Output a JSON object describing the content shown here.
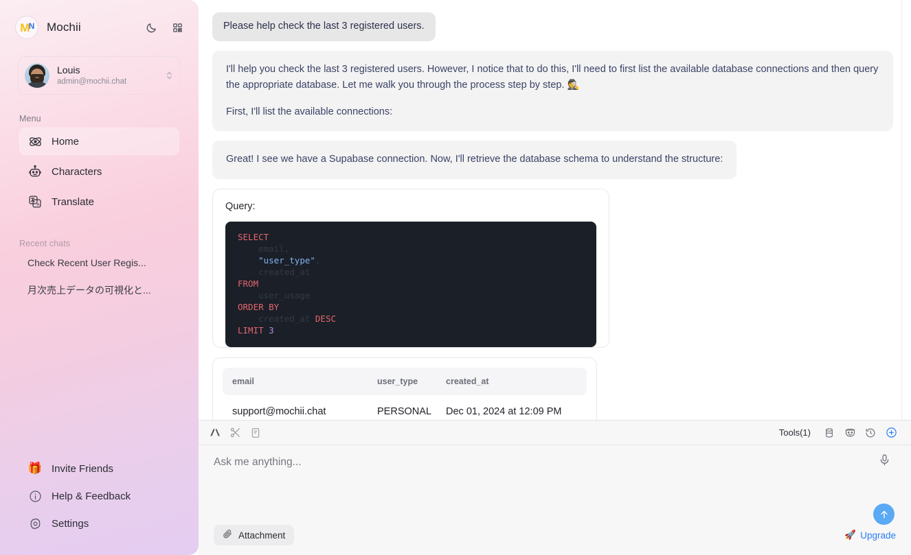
{
  "sidebar": {
    "brand": {
      "name": "Mochii",
      "logo_letter": "M",
      "logo_accent": "ᴺ"
    },
    "header_icons": [
      {
        "name": "dark-mode-toggle",
        "icon": "moon-icon"
      },
      {
        "name": "qr-code-button",
        "icon": "qr-code-icon"
      }
    ],
    "user": {
      "name": "Louis",
      "email": "admin@mochii.chat"
    },
    "menu_label": "Menu",
    "items": [
      {
        "label": "Home",
        "icon": "atom-icon",
        "active": true
      },
      {
        "label": "Characters",
        "icon": "robot-icon",
        "active": false
      },
      {
        "label": "Translate",
        "icon": "translate-icon",
        "active": false
      }
    ],
    "recent_label": "Recent chats",
    "recent": [
      {
        "label": "Check Recent User Regis..."
      },
      {
        "label": "月次売上データの可視化と..."
      }
    ],
    "bottom": [
      {
        "label": "Invite Friends",
        "icon": "gift-icon"
      },
      {
        "label": "Help & Feedback",
        "icon": "info-circle-icon"
      },
      {
        "label": "Settings",
        "icon": "gear-icon"
      }
    ]
  },
  "chat": {
    "user_message": "Please help check the last 3 registered users.",
    "assistant_message_1_p1": "I'll help you check the last 3 registered users. However, I notice that to do this, I'll need to first list the available database connections and then query the appropriate database. Let me walk you through the process step by step. 🕵️",
    "assistant_message_1_p2": "First, I'll list the available connections:",
    "assistant_message_2": "Great! I see we have a Supabase connection. Now, I'll retrieve the database schema to understand the structure:",
    "query_card": {
      "title": "Query:",
      "sql_lines": [
        {
          "parts": [
            {
              "t": "SELECT",
              "c": "kw"
            }
          ]
        },
        {
          "parts": [
            {
              "t": "    email,",
              "c": "dim"
            }
          ]
        },
        {
          "parts": [
            {
              "t": "    ",
              "c": "dim"
            },
            {
              "t": "\"user_type\"",
              "c": "str"
            },
            {
              "t": ",",
              "c": "dim"
            }
          ]
        },
        {
          "parts": [
            {
              "t": "    created_at",
              "c": "dim"
            }
          ]
        },
        {
          "parts": [
            {
              "t": "FROM",
              "c": "kw"
            }
          ]
        },
        {
          "parts": [
            {
              "t": "    user_usage",
              "c": "dim"
            }
          ]
        },
        {
          "parts": [
            {
              "t": "ORDER BY",
              "c": "kw"
            }
          ]
        },
        {
          "parts": [
            {
              "t": "    created_at ",
              "c": "dim"
            },
            {
              "t": "DESC",
              "c": "kw"
            }
          ]
        },
        {
          "parts": [
            {
              "t": "LIMIT ",
              "c": "kw"
            },
            {
              "t": "3",
              "c": "num"
            }
          ]
        }
      ]
    },
    "result_table": {
      "columns": [
        "email",
        "user_type",
        "created_at"
      ],
      "rows": [
        [
          "support@mochii.chat",
          "PERSONAL",
          "Dec 01, 2024 at 12:09 PM"
        ]
      ]
    }
  },
  "composer": {
    "left_tools": [
      {
        "name": "ai-logo-button",
        "icon": "anthropic-ai-icon"
      },
      {
        "name": "cut-button",
        "icon": "scissors-icon"
      },
      {
        "name": "notes-button",
        "icon": "note-icon"
      }
    ],
    "tools_label": "Tools(1)",
    "right_tools": [
      {
        "name": "database-tool-button",
        "icon": "database-icon"
      },
      {
        "name": "persona-tool-button",
        "icon": "theater-masks-icon"
      },
      {
        "name": "history-tool-button",
        "icon": "history-clock-icon"
      },
      {
        "name": "add-tool-button",
        "icon": "plus-circle-icon"
      }
    ],
    "placeholder": "Ask me anything...",
    "mic_icon": "microphone-icon",
    "send_icon": "arrow-up-icon",
    "attachment_label": "Attachment",
    "upgrade_label": "Upgrade",
    "upgrade_icon": "rocket-icon"
  },
  "colors": {
    "accent_blue": "#2a7ef0",
    "send_blue": "#5aa9f5",
    "code_bg": "#1b1f27",
    "keyword_red": "#e4666f",
    "string_blue": "#7fb3f0",
    "sidebar_pink": "#f9cfdd",
    "sidebar_purple": "#e4cdf2"
  }
}
